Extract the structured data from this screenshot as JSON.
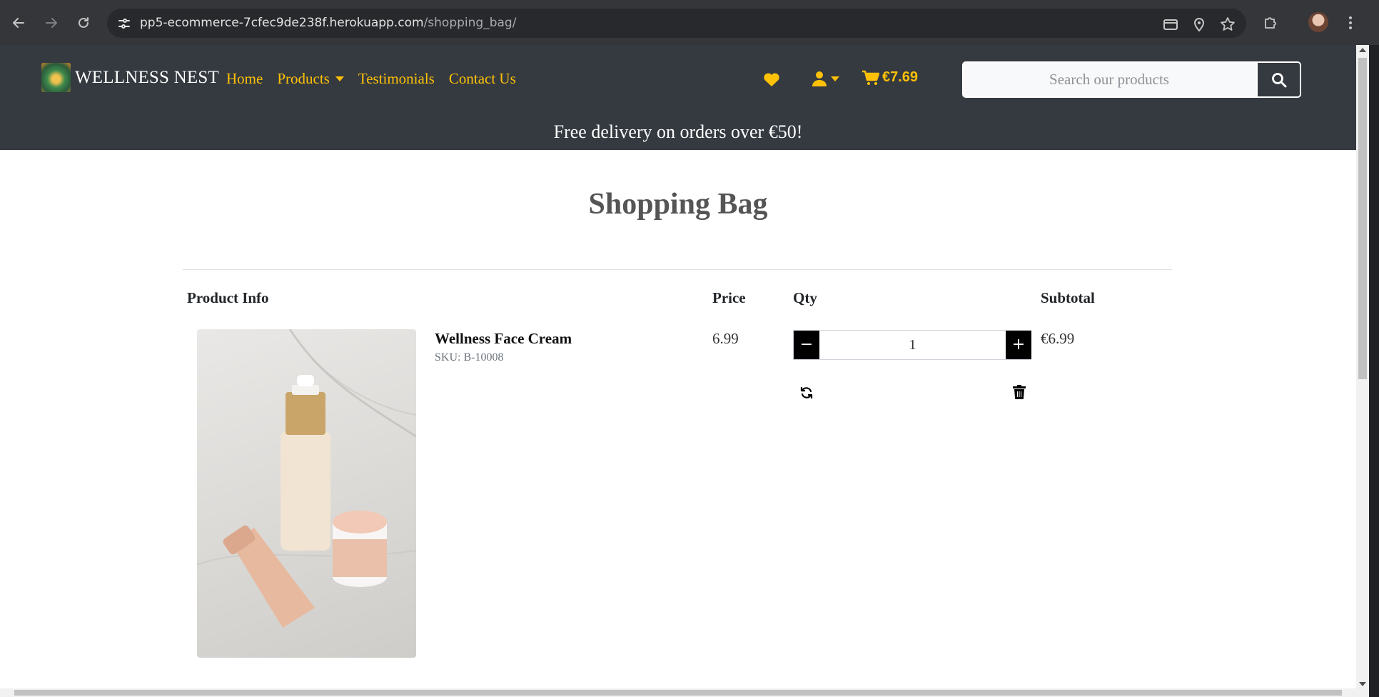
{
  "browser": {
    "url_host": "pp5-ecommerce-7cfec9de238f.herokuapp.com",
    "url_path": "/shopping_bag/"
  },
  "header": {
    "brand": "WELLNESS NEST",
    "nav": [
      {
        "label": "Home"
      },
      {
        "label": "Products"
      },
      {
        "label": "Testimonials"
      },
      {
        "label": "Contact Us"
      }
    ],
    "cart_total": "€7.69",
    "search_placeholder": "Search our products",
    "banner": "Free delivery on orders over €50!"
  },
  "colors": {
    "accent": "#ffc107",
    "header_bg": "#343a40"
  },
  "page": {
    "title": "Shopping Bag",
    "columns": {
      "product": "Product Info",
      "price": "Price",
      "qty": "Qty",
      "subtotal": "Subtotal"
    },
    "items": [
      {
        "name": "Wellness Face Cream",
        "sku": "SKU: B-10008",
        "price": "6.99",
        "quantity": "1",
        "subtotal": "€6.99",
        "minus_label": "−",
        "plus_label": "+"
      }
    ]
  },
  "icons": {
    "back": "arrow-left-icon",
    "forward": "arrow-right-icon",
    "reload": "reload-icon",
    "site_info": "tune-icon",
    "card": "credit-card-icon",
    "location": "location-pin-icon",
    "bookmark": "star-icon",
    "extensions": "puzzle-icon",
    "menu": "kebab-menu-icon",
    "wishlist": "heart-icon",
    "account": "user-icon",
    "cart": "cart-icon",
    "search": "search-icon",
    "update": "refresh-icon",
    "remove": "trash-icon"
  }
}
